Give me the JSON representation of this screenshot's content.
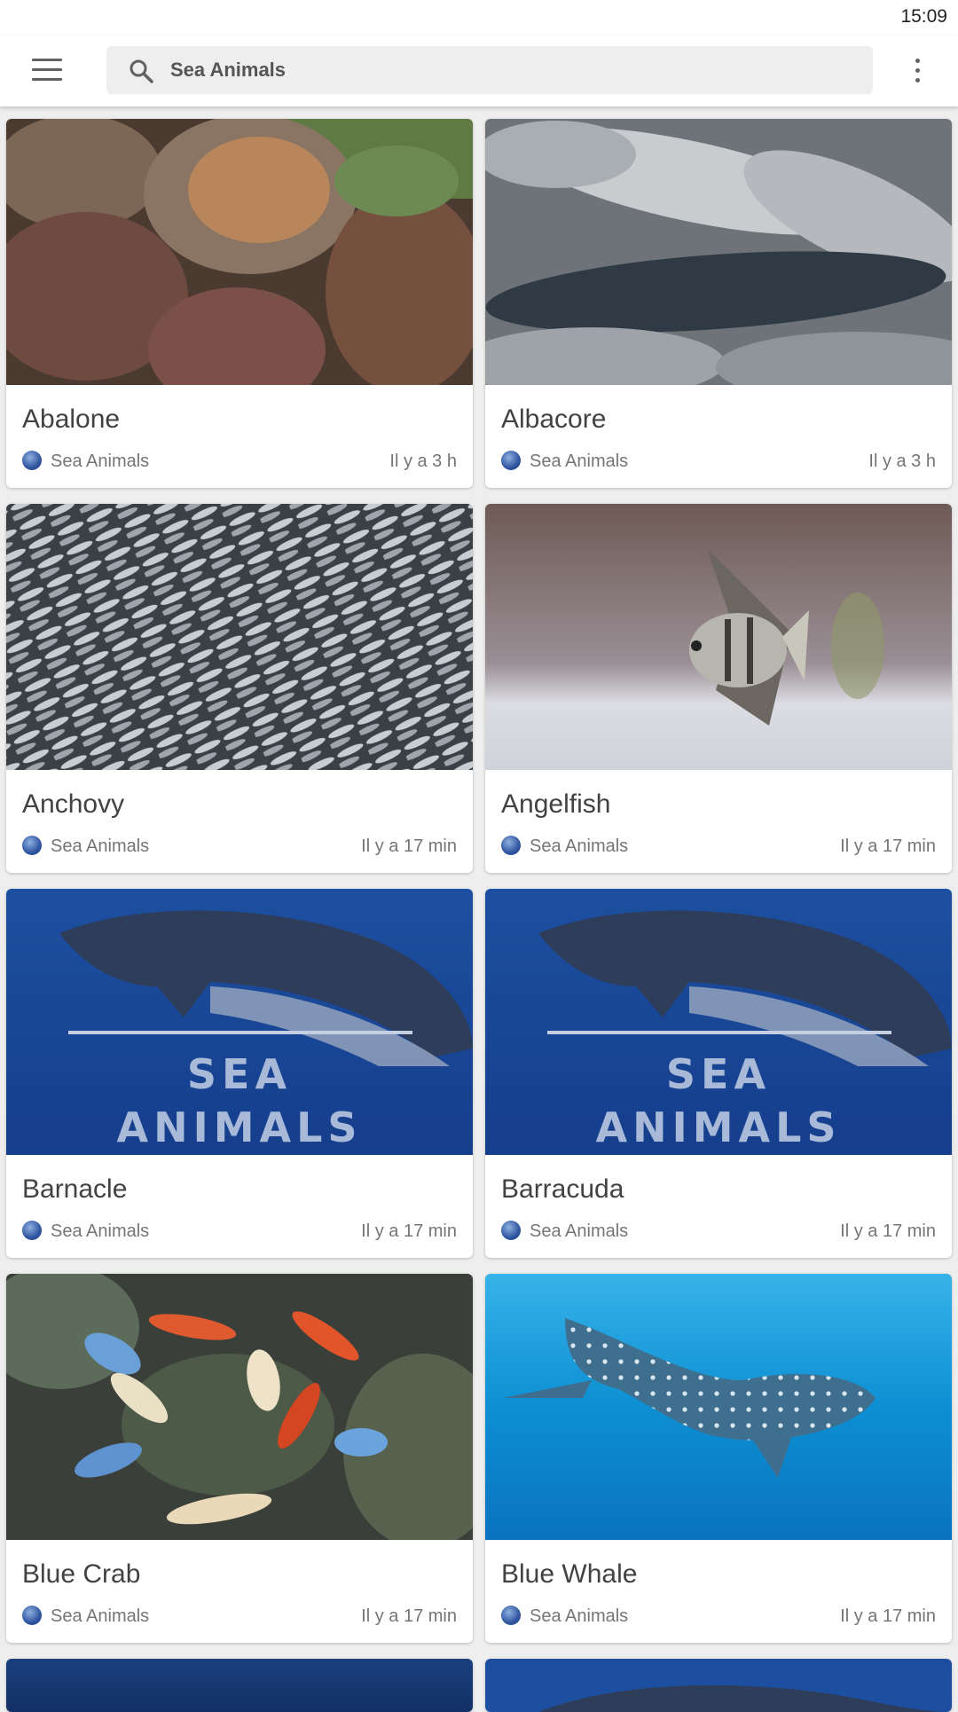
{
  "status_bar": {
    "time": "15:09"
  },
  "app_bar": {
    "menu_icon": "hamburger-menu-icon",
    "search": {
      "icon": "search-icon",
      "text": "Sea Animals"
    },
    "overflow_icon": "more-vert-icon"
  },
  "cards": [
    {
      "title": "Abalone",
      "source": "Sea Animals",
      "time": "Il y a 3 h",
      "image": "abalone-photo"
    },
    {
      "title": "Albacore",
      "source": "Sea Animals",
      "time": "Il y a 3 h",
      "image": "albacore-photo"
    },
    {
      "title": "Anchovy",
      "source": "Sea Animals",
      "time": "Il y a 17 min",
      "image": "anchovy-photo"
    },
    {
      "title": "Angelfish",
      "source": "Sea Animals",
      "time": "Il y a 17 min",
      "image": "angelfish-photo"
    },
    {
      "title": "Barnacle",
      "source": "Sea Animals",
      "time": "Il y a 17 min",
      "image": "sea-animals-placeholder"
    },
    {
      "title": "Barracuda",
      "source": "Sea Animals",
      "time": "Il y a 17 min",
      "image": "sea-animals-placeholder"
    },
    {
      "title": "Blue Crab",
      "source": "Sea Animals",
      "time": "Il y a 17 min",
      "image": "blue-crab-photo"
    },
    {
      "title": "Blue Whale",
      "source": "Sea Animals",
      "time": "Il y a 17 min",
      "image": "whale-shark-photo"
    }
  ],
  "placeholder_text": {
    "line1": "SEA",
    "line2": "ANIMALS"
  }
}
